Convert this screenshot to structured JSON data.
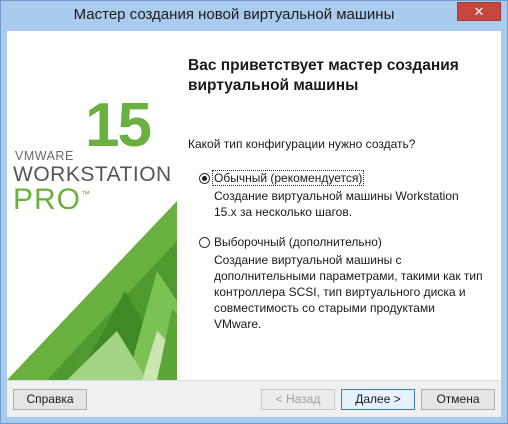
{
  "window": {
    "title": "Мастер создания новой виртуальной машины",
    "close_label": "✕"
  },
  "banner": {
    "vmware": "VMWARE",
    "version": "15",
    "workstation": "WORKSTATION",
    "pro": "PRO",
    "tm": "™"
  },
  "content": {
    "heading": "Вас приветствует мастер создания виртуальной машины",
    "question": "Какой тип конфигурации нужно создать?",
    "options": [
      {
        "label": "Обычный (рекомендуется)",
        "selected": true,
        "description": "Создание виртуальной машины Workstation 15.x за несколько шагов."
      },
      {
        "label": "Выборочный (дополнительно)",
        "selected": false,
        "description": "Создание виртуальной машины с дополнительными параметрами, такими как тип контроллера SCSI, тип виртуального диска и совместимость со старыми продуктами VMware."
      }
    ]
  },
  "footer": {
    "help": "Справка",
    "back": "< Назад",
    "next": "Далее >",
    "cancel": "Отмена"
  },
  "colors": {
    "brand_green": "#6ab040",
    "titlebar": "#a9cbee",
    "close": "#c7463e"
  }
}
